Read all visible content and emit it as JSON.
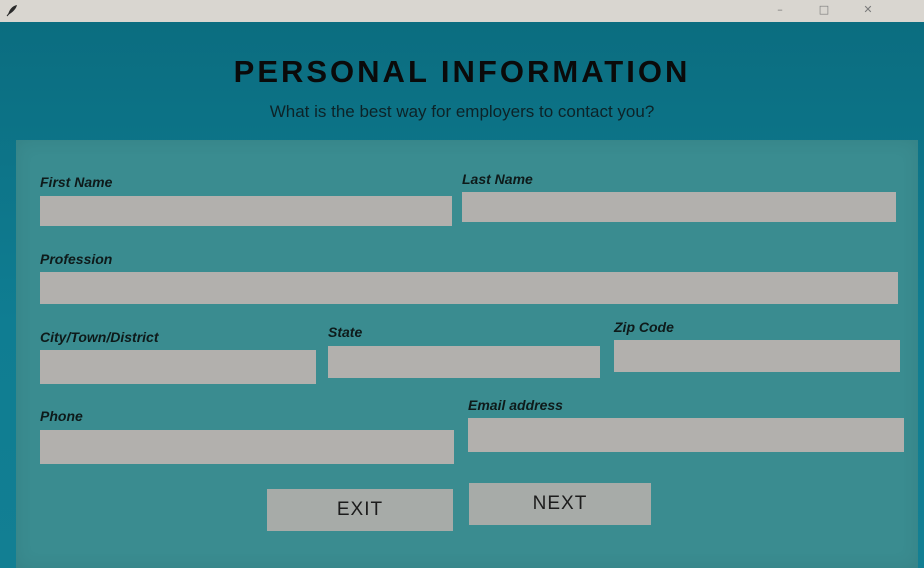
{
  "window": {
    "controls": {
      "minimize": "–",
      "maximize": "□",
      "close": "✕"
    },
    "app_icon": "feather-icon"
  },
  "form": {
    "title": "PERSONAL INFORMATION",
    "subtitle": "What is the best way for employers to contact you?",
    "fields": {
      "first_name": {
        "label": "First Name",
        "value": ""
      },
      "last_name": {
        "label": "Last Name",
        "value": ""
      },
      "profession": {
        "label": "Profession",
        "value": ""
      },
      "city": {
        "label": "City/Town/District",
        "value": ""
      },
      "state": {
        "label": "State",
        "value": ""
      },
      "zip": {
        "label": "Zip Code",
        "value": ""
      },
      "phone": {
        "label": "Phone",
        "value": ""
      },
      "email": {
        "label": "Email address",
        "value": ""
      }
    },
    "buttons": {
      "exit": "EXIT",
      "next": "NEXT"
    }
  },
  "colors": {
    "window_bg": "#0f7d92",
    "form_bg": "#3a8c90",
    "field_bg": "#b2b0ad",
    "button_bg": "#a7aba8"
  }
}
